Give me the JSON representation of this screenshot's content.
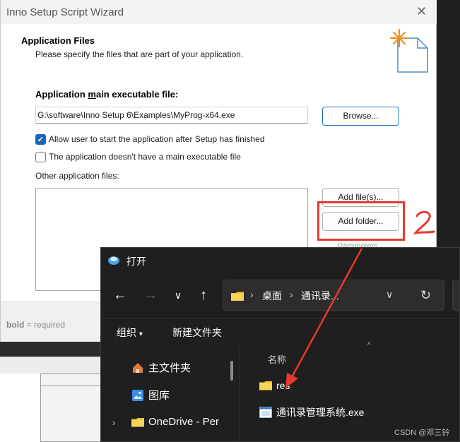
{
  "wizard": {
    "title": "Inno Setup Script Wizard",
    "close_icon": "close-icon",
    "header_title": "Application Files",
    "header_subtitle": "Please specify the files that are part of your application.",
    "main_exe_label_pre": "Application ",
    "main_exe_label_underlined": "m",
    "main_exe_label_post": "ain executable file:",
    "main_exe_value": "G:\\software\\Inno Setup 6\\Examples\\MyProg-x64.exe",
    "browse_label": "Browse...",
    "allow_start_label": "Allow user to start the application after Setup has finished",
    "allow_start_checked": true,
    "no_main_exe_label": "The application doesn't have a main executable file",
    "no_main_exe_checked": false,
    "other_files_label": "Other application files:",
    "add_files_label": "Add file(s)...",
    "add_folder_label": "Add folder...",
    "parameters_label": "Parameters...",
    "footer_hint_bold": "bold",
    "footer_hint_rest": " = required",
    "highlight_color": "#e53a2f",
    "annotation_glyph": "2"
  },
  "open_dialog": {
    "title": "打开",
    "nav": {
      "back_icon": "arrow-left-icon",
      "forward_icon": "arrow-right-icon",
      "recent_icon": "chevron-down-icon",
      "up_icon": "arrow-up-icon"
    },
    "breadcrumb": [
      "桌面",
      "通讯录..."
    ],
    "organize_label": "组织",
    "new_folder_label": "新建文件夹",
    "nav_pane": [
      {
        "label": "主文件夹",
        "icon": "home-icon"
      },
      {
        "label": "图库",
        "icon": "gallery-icon"
      },
      {
        "label": "OneDrive - Per",
        "icon": "folder-icon"
      }
    ],
    "column_header": "名称",
    "files": [
      {
        "name": "res",
        "icon": "folder-icon"
      },
      {
        "name": "通讯录管理系统.exe",
        "icon": "exe-icon"
      }
    ]
  },
  "watermark": "CSDN @邓三钤"
}
